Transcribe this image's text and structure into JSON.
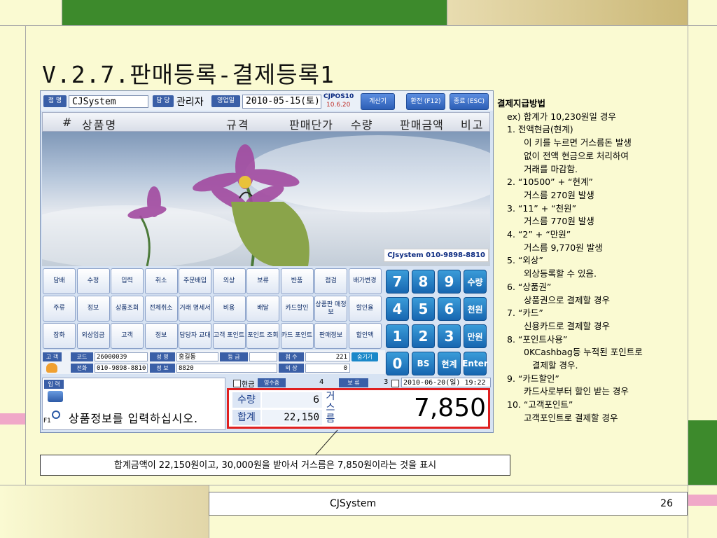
{
  "slide": {
    "title": "V.2.7.판매등록-결제등록1",
    "footer_text": "CJSystem",
    "page_number": "26",
    "caption": "합계금액이 22,150원이고, 30,000원을 받아서 거스름은 7,850원이라는 것을 표시"
  },
  "pos": {
    "header": {
      "store_label": "점 명",
      "store_value": "CJSystem",
      "manager_label": "담 당",
      "manager_value": "관리자",
      "bizdate_label": "영업일",
      "bizdate_value": "2010-05-15(토)",
      "version_name": "CJPOS10",
      "version_date": "10.6.20",
      "calc_btn": "계산기",
      "exchange_btn": "환전 (F12)",
      "exit_btn": "종료 (ESC)"
    },
    "columns": [
      "#",
      "상품명",
      "규격",
      "판매단가",
      "수량",
      "판매금액",
      "비고"
    ],
    "brand": "CJsystem 010-9898-8810",
    "func_buttons": [
      [
        "담배",
        "수정",
        "입력",
        "취소",
        "주문배입",
        "외상",
        "보류",
        "반품",
        "점검",
        "배가변경"
      ],
      [
        "주류",
        "정보",
        "상품조회",
        "전체취소",
        "거래 명세서",
        "비용",
        "배달",
        "카드할인",
        "상품판 매정보",
        "할인율"
      ],
      [
        "잡화",
        "외상입금",
        "고객",
        "정보",
        "담당자 교대",
        "고객 포인트",
        "포인트 조회",
        "카드 포인트",
        "판매정보",
        "할인액"
      ]
    ],
    "numpad": {
      "row1": [
        "7",
        "8",
        "9",
        "수량"
      ],
      "row2": [
        "4",
        "5",
        "6",
        "천원"
      ],
      "row3": [
        "1",
        "2",
        "3",
        "만원"
      ],
      "row4": [
        "0",
        "BS",
        "현계",
        "Enter"
      ]
    },
    "customer": {
      "cust_label": "고 객",
      "code_label": "코드",
      "code_value": "26000039",
      "name_label": "성 명",
      "name_value": "홍길동",
      "grade_label": "등 급",
      "points_label": "점 수",
      "points_value": "221",
      "hide_btn": "숨기기",
      "phone_label": "전화",
      "phone_value": "010-9898-8810",
      "info_label": "정 보",
      "info_value": "8820",
      "credit_label": "외 상",
      "credit_value": "0"
    },
    "input_label": "입 력",
    "status": {
      "cash_label": "현금",
      "receipt_btn": "영수증",
      "receipt_count": "4",
      "hold_btn": "보 류",
      "hold_count": "3",
      "datetime": "2010-06-20(일) 19:22"
    },
    "totals": {
      "qty_label": "수량",
      "qty_value": "6",
      "sum_label": "합계",
      "sum_value": "22,150",
      "change_label_1": "거",
      "change_label_2": "스",
      "change_label_3": "름",
      "change_value": "7,850"
    },
    "fkey": "F1",
    "message": "상품정보를 입력하십시오."
  },
  "notes": {
    "heading": "결제지급방법",
    "lines": [
      "ex) 합계가 10,230원일 경우",
      "1. 전액현금(현계)",
      "이 키를 누르면 거스름돈 발생",
      "없이 전액 현금으로 처리하여",
      "거래를 마감함.",
      "2. “10500” + “현계”",
      "거스름 270원 발생",
      "3. “11” + “천원”",
      "거스름 770원 발생",
      "4. “2” + “만원”",
      "거스름 9,770원 발생",
      "5. “외상”",
      "외상등록할 수 있음.",
      "6. “상품권”",
      "상품권으로 결제할 경우",
      "7. “카드”",
      "신용카드로 결제할 경우",
      "8. “포인트사용”",
      "0KCashbag등 누적된 포인트로",
      "결제할 경우.",
      "9. “카드할인”",
      "카드사로부터 할인 받는 경우",
      "10. “고객포인트”",
      "고객포인트로 결제할 경우"
    ]
  },
  "colors": {
    "slide_bg": "#fafad2",
    "highlight_red": "#e02020",
    "pos_blue": "#3a5fa7",
    "numpad_blue": "#1766b0",
    "deco_green": "#3d8a2c",
    "deco_tan": "#d4c48a",
    "deco_pink": "#f0a8c8"
  }
}
